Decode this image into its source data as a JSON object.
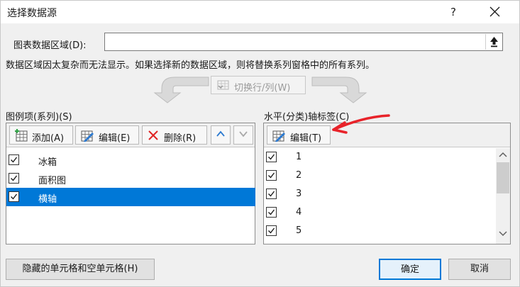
{
  "window": {
    "title": "选择数据源",
    "help_label": "?",
    "close_icon": "close-icon"
  },
  "data_range": {
    "label": "图表数据区域(D):",
    "value": "",
    "collapse_icon": "collapse-up-arrow-icon"
  },
  "info_text": "数据区域因太复杂而无法显示。如果选择新的数据区域，则将替换系列窗格中的所有系列。",
  "switch_button": {
    "label": "切换行/列(W)",
    "enabled": false
  },
  "legend_panel": {
    "title": "图例项(系列)(S)",
    "toolbar": {
      "add_label": "添加(A)",
      "edit_label": "编辑(E)",
      "delete_label": "删除(R)"
    },
    "items": [
      {
        "label": "冰箱",
        "checked": true,
        "selected": false
      },
      {
        "label": "面积图",
        "checked": true,
        "selected": false
      },
      {
        "label": "横轴",
        "checked": true,
        "selected": true
      }
    ]
  },
  "axis_panel": {
    "title": "水平(分类)轴标签(C)",
    "toolbar": {
      "edit_label": "编辑(T)"
    },
    "items": [
      {
        "label": "1",
        "checked": true
      },
      {
        "label": "2",
        "checked": true
      },
      {
        "label": "3",
        "checked": true
      },
      {
        "label": "4",
        "checked": true
      },
      {
        "label": "5",
        "checked": true
      }
    ]
  },
  "footer": {
    "hidden_cells_label": "隐藏的单元格和空单元格(H)",
    "ok_label": "确定",
    "cancel_label": "取消"
  },
  "colors": {
    "accent": "#0078d7",
    "annotation": "#e8232a"
  }
}
